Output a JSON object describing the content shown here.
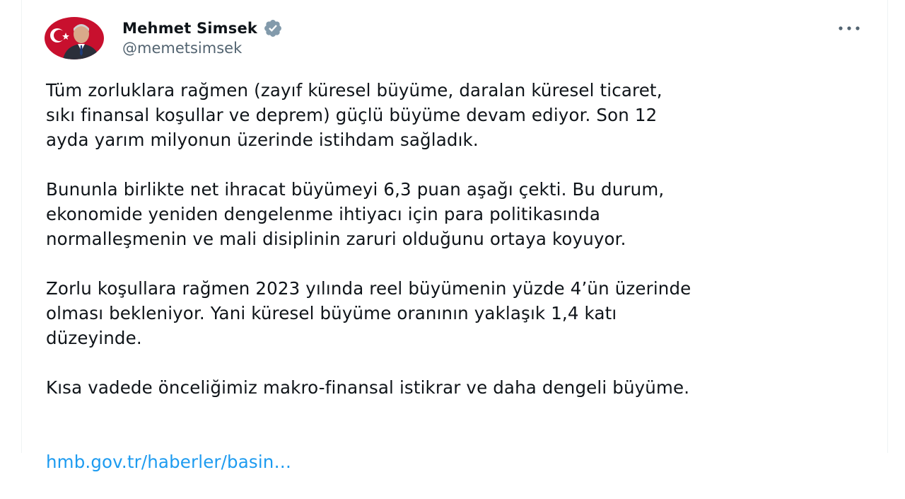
{
  "author": {
    "name": "Mehmet Simsek",
    "handle": "@memetsimsek",
    "verified": true,
    "verified_color": "#829aab"
  },
  "menu": {
    "more_label": "···"
  },
  "tweet": {
    "paragraphs": [
      "Tüm zorluklara rağmen (zayıf küresel büyüme, daralan küresel ticaret,\nsıkı finansal koşullar ve deprem) güçlü büyüme devam ediyor. Son 12\nayda yarım milyonun üzerinde istihdam sağladık.",
      "Bununla birlikte net ihracat büyümeyi 6,3 puan aşağı çekti. Bu durum,\nekonomide yeniden dengelenme ihtiyacı için para politikasında\nnormalleşmenin ve mali disiplinin zaruri olduğunu ortaya koyuyor.",
      "Zorlu koşullara rağmen 2023 yılında reel büyümenin yüzde 4’ün üzerinde\nolması bekleniyor. Yani küresel büyüme oranının yaklaşık 1,4 katı\ndüzeyinde.",
      "Kısa vadede önceliğimiz makro-finansal istikrar ve daha dengeli büyüme."
    ],
    "link_text": "hmb.gov.tr/haberler/basin…"
  },
  "colors": {
    "text": "#0f1419",
    "secondary": "#536471",
    "link": "#1d9bf0"
  }
}
